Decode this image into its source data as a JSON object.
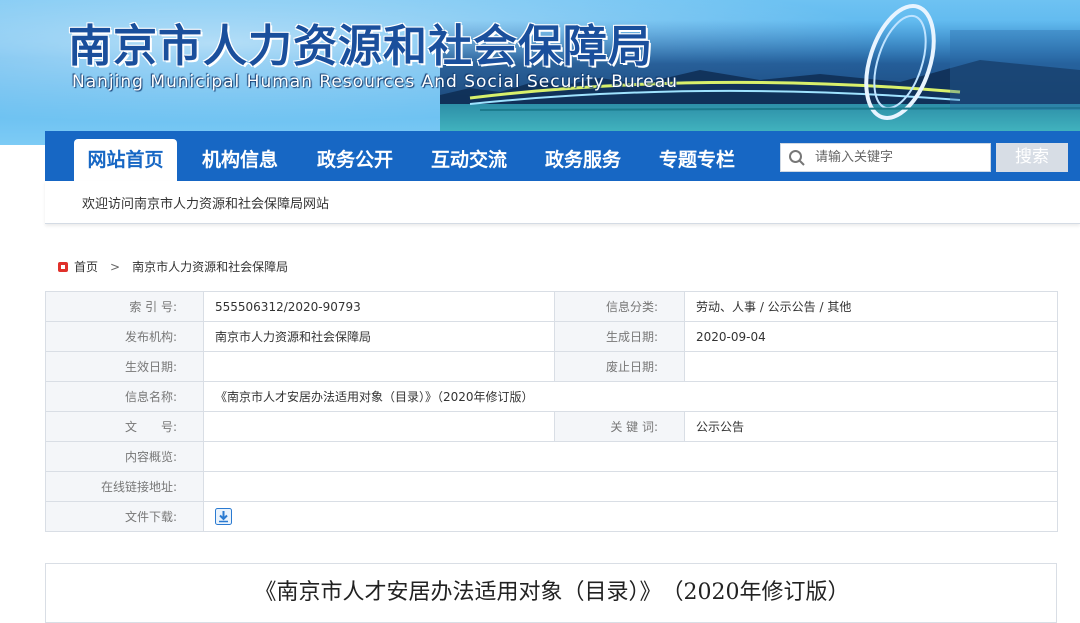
{
  "header": {
    "title": "南京市人力资源和社会保障局",
    "subtitle": "Nanjing Municipal Human Resources And Social Security Bureau"
  },
  "nav": {
    "items": [
      {
        "label": "网站首页",
        "active": true
      },
      {
        "label": "机构信息",
        "active": false
      },
      {
        "label": "政务公开",
        "active": false
      },
      {
        "label": "互动交流",
        "active": false
      },
      {
        "label": "政务服务",
        "active": false
      },
      {
        "label": "专题专栏",
        "active": false
      }
    ],
    "search_placeholder": "请输入关键字",
    "search_button": "搜索"
  },
  "welcome": "欢迎访问南京市人力资源和社会保障局网站",
  "breadcrumb": {
    "home": "首页",
    "separator": ">",
    "current": "南京市人力资源和社会保障局"
  },
  "info": {
    "index_label": "索 引 号:",
    "index_value": "555506312/2020-90793",
    "category_label": "信息分类:",
    "category_value": "劳动、人事 / 公示公告 / 其他",
    "publisher_label": "发布机构:",
    "publisher_value": "南京市人力资源和社会保障局",
    "created_label": "生成日期:",
    "created_value": "2020-09-04",
    "effective_label": "生效日期:",
    "effective_value": "",
    "expire_label": "废止日期:",
    "expire_value": "",
    "name_label": "信息名称:",
    "name_value": "《南京市人才安居办法适用对象（目录）》（2020年修订版）",
    "docno_label": "文　　号:",
    "docno_value": "",
    "keywords_label": "关 键 词:",
    "keywords_value": "公示公告",
    "summary_label": "内容概览:",
    "summary_value": "",
    "link_label": "在线链接地址:",
    "link_value": "",
    "download_label": "文件下载:"
  },
  "article": {
    "title": "《南京市人才安居办法适用对象（目录）》　（2020年修订版）"
  },
  "colors": {
    "nav_bg": "#1767c4",
    "title_blue": "#1a4f9c",
    "breadcrumb_icon": "#e0312b",
    "label_bg": "#f4f6f9"
  }
}
